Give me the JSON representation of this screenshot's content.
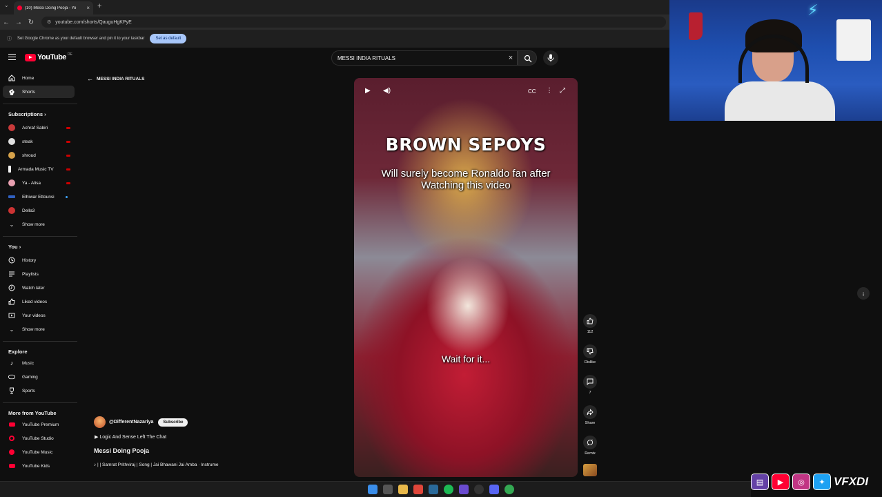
{
  "browser": {
    "tab_title": "(10) Messi Doing Pooja - Yo",
    "url": "youtube.com/shorts/QauguHgKPyE",
    "infobar_text": "Set Google Chrome as your default browser and pin it to your taskbar",
    "infobar_button": "Set as default"
  },
  "header": {
    "logo_text": "YouTube",
    "logo_region": "DE",
    "search_value": "MESSI INDIA RITUALS"
  },
  "sidebar": {
    "main": [
      {
        "label": "Home",
        "icon": "home-icon"
      },
      {
        "label": "Shorts",
        "icon": "shorts-icon"
      }
    ],
    "subscriptions_heading": "Subscriptions",
    "subscriptions": [
      {
        "label": "Achraf Sabiri",
        "color": "#c83a3a"
      },
      {
        "label": "steak",
        "color": "#e0e0e0"
      },
      {
        "label": "shroud",
        "color": "#d6a24a"
      },
      {
        "label": "Armada Music TV",
        "color": "#f1f1f1"
      },
      {
        "label": "Ya - Alisa",
        "color": "#e8a0b0"
      },
      {
        "label": "Elhiwar Ettounsi",
        "color": "#3060c0"
      },
      {
        "label": "Della3",
        "color": "#cc3333"
      }
    ],
    "show_more": "Show more",
    "you_heading": "You",
    "you": [
      {
        "label": "History",
        "icon": "history-icon"
      },
      {
        "label": "Playlists",
        "icon": "playlists-icon"
      },
      {
        "label": "Watch later",
        "icon": "watch-later-icon"
      },
      {
        "label": "Liked videos",
        "icon": "liked-videos-icon"
      },
      {
        "label": "Your videos",
        "icon": "your-videos-icon"
      }
    ],
    "show_more_2": "Show more",
    "explore_heading": "Explore",
    "explore": [
      {
        "label": "Music",
        "icon": "music-icon"
      },
      {
        "label": "Gaming",
        "icon": "gaming-icon"
      },
      {
        "label": "Sports",
        "icon": "sports-icon"
      }
    ],
    "more_heading": "More from YouTube",
    "more": [
      {
        "label": "YouTube Premium"
      },
      {
        "label": "YouTube Studio"
      },
      {
        "label": "YouTube Music"
      },
      {
        "label": "YouTube Kids"
      }
    ]
  },
  "back_link": "MESSI INDIA RITUALS",
  "video": {
    "overlay_title": "BROWN SEPOYS",
    "overlay_subtitle": "Will surely become Ronaldo fan after Watching this video",
    "overlay_bottom": "Wait for it..."
  },
  "actions": {
    "likes": "112",
    "dislike": "Dislike",
    "comments": "7",
    "share": "Share",
    "remix": "Remix"
  },
  "meta": {
    "channel": "@DifferentNazariya",
    "subscribe": "Subscribe",
    "playlist": "Logic And Sense Left The Chat",
    "title": "Messi Doing Pooja",
    "music": "♪ | | Samrat Prithviraj | Song | Jai Bhawani Jai Amba · Instrume"
  },
  "overlay": {
    "social_handle": "VFXDI"
  }
}
